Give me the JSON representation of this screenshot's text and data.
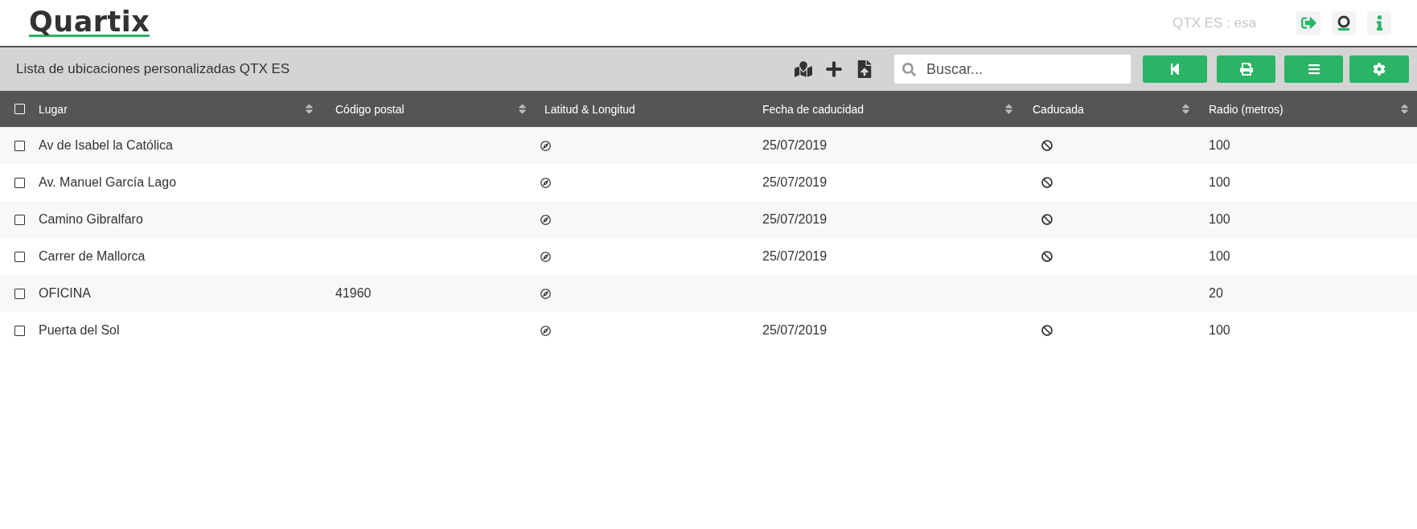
{
  "header": {
    "logo": "Quartix",
    "account": "QTX ES : esa"
  },
  "toolbar": {
    "title": "Lista de ubicaciones personalizadas QTX ES",
    "search": {
      "placeholder": "Buscar..."
    }
  },
  "table": {
    "select_all": {
      "checked": false
    },
    "columns": [
      {
        "label": "Lugar",
        "sortable": true
      },
      {
        "label": "Código postal",
        "sortable": true
      },
      {
        "label": "Latitud & Longitud",
        "sortable": false
      },
      {
        "label": "Fecha de caducidad",
        "sortable": true
      },
      {
        "label": "Caducada",
        "sortable": true
      },
      {
        "label": "Radio (metros)",
        "sortable": true
      }
    ],
    "rows": [
      {
        "checked": false,
        "place": "Av de Isabel la Católica",
        "postcode": "",
        "expiry": "25/07/2019",
        "expired": true,
        "radius": "100"
      },
      {
        "checked": false,
        "place": "Av. Manuel García Lago",
        "postcode": "",
        "expiry": "25/07/2019",
        "expired": true,
        "radius": "100"
      },
      {
        "checked": false,
        "place": "Camino Gibralfaro",
        "postcode": "",
        "expiry": "25/07/2019",
        "expired": true,
        "radius": "100"
      },
      {
        "checked": false,
        "place": "Carrer de Mallorca",
        "postcode": "",
        "expiry": "25/07/2019",
        "expired": true,
        "radius": "100"
      },
      {
        "checked": false,
        "place": "OFICINA",
        "postcode": "41960",
        "expiry": "",
        "expired": false,
        "radius": "20"
      },
      {
        "checked": false,
        "place": "Puerta del Sol",
        "postcode": "",
        "expiry": "25/07/2019",
        "expired": true,
        "radius": "100"
      }
    ]
  }
}
